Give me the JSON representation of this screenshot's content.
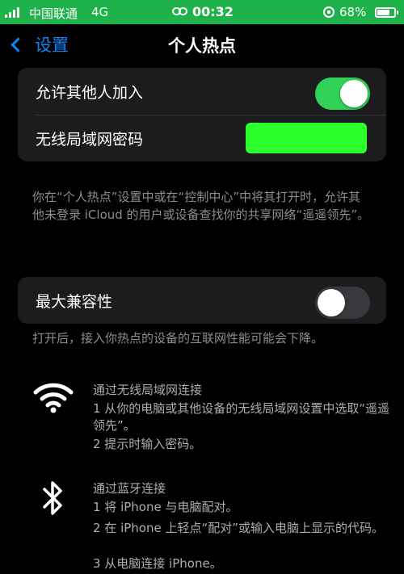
{
  "status_bar": {
    "carrier": "中国联通",
    "network": "4G",
    "time": "00:32",
    "battery_percent": "68%",
    "battery_level": 0.68,
    "accent_color": "#1fb14a"
  },
  "nav": {
    "back_label": "设置",
    "title": "个人热点"
  },
  "hotspot_group": {
    "allow_others": {
      "label": "允许其他人加入",
      "enabled": true
    },
    "wifi_password": {
      "label": "无线局域网密码",
      "value_redacted": true
    }
  },
  "note_1": "你在“个人热点”设置中或在“控制中心”中将其打开时，允许其他未登录 iCloud 的用户或设备查找你的共享网络“遥遥领先”。",
  "compat_group": {
    "max_compat": {
      "label": "最大兼容性",
      "enabled": false
    }
  },
  "note_2": "打开后，接入你热点的设备的互联网性能可能会下降。",
  "wifi_method": {
    "icon": "wifi-icon",
    "title": "通过无线局域网连接",
    "steps": [
      "1 从你的电脑或其他设备的无线局域网设置中选取“遥遥领先”。",
      "2 提示时输入密码。"
    ]
  },
  "bt_method": {
    "icon": "bluetooth-icon",
    "title": "通过蓝牙连接",
    "steps": [
      "1 将 iPhone 与电脑配对。",
      "2 在 iPhone 上轻点“配对”或输入电脑上显示的代码。",
      "3 从电脑连接 iPhone。"
    ]
  },
  "colors": {
    "toggle_on": "#32d158",
    "link_blue": "#0a84ff",
    "redaction": "#2cff2c"
  }
}
